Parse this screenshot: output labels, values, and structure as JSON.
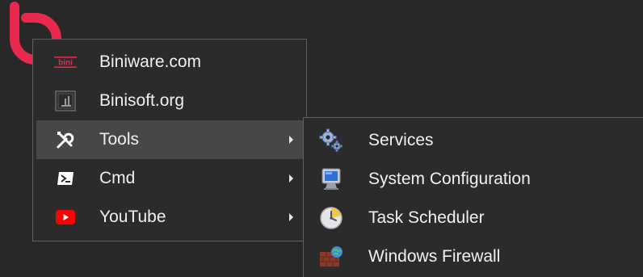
{
  "colors": {
    "background": "#282828",
    "menu_background": "#2b2b2b",
    "menu_border": "#5f5f5f",
    "highlight": "#474747",
    "text": "#f0f0f0",
    "brand_red": "#e8294d",
    "youtube_red": "#ff0000"
  },
  "main_menu": {
    "items": [
      {
        "label": "Biniware.com",
        "icon": "biniware-logo-icon",
        "has_submenu": false
      },
      {
        "label": "Binisoft.org",
        "icon": "binisoft-logo-icon",
        "has_submenu": false
      },
      {
        "label": "Tools",
        "icon": "tools-icon",
        "has_submenu": true,
        "highlighted": true
      },
      {
        "label": "Cmd",
        "icon": "terminal-icon",
        "has_submenu": true
      },
      {
        "label": "YouTube",
        "icon": "youtube-icon",
        "has_submenu": true
      }
    ]
  },
  "tools_submenu": {
    "items": [
      {
        "label": "Services",
        "icon": "gears-icon"
      },
      {
        "label": "System Configuration",
        "icon": "monitor-icon"
      },
      {
        "label": "Task Scheduler",
        "icon": "clock-icon"
      },
      {
        "label": "Windows Firewall",
        "icon": "firewall-icon"
      }
    ]
  }
}
